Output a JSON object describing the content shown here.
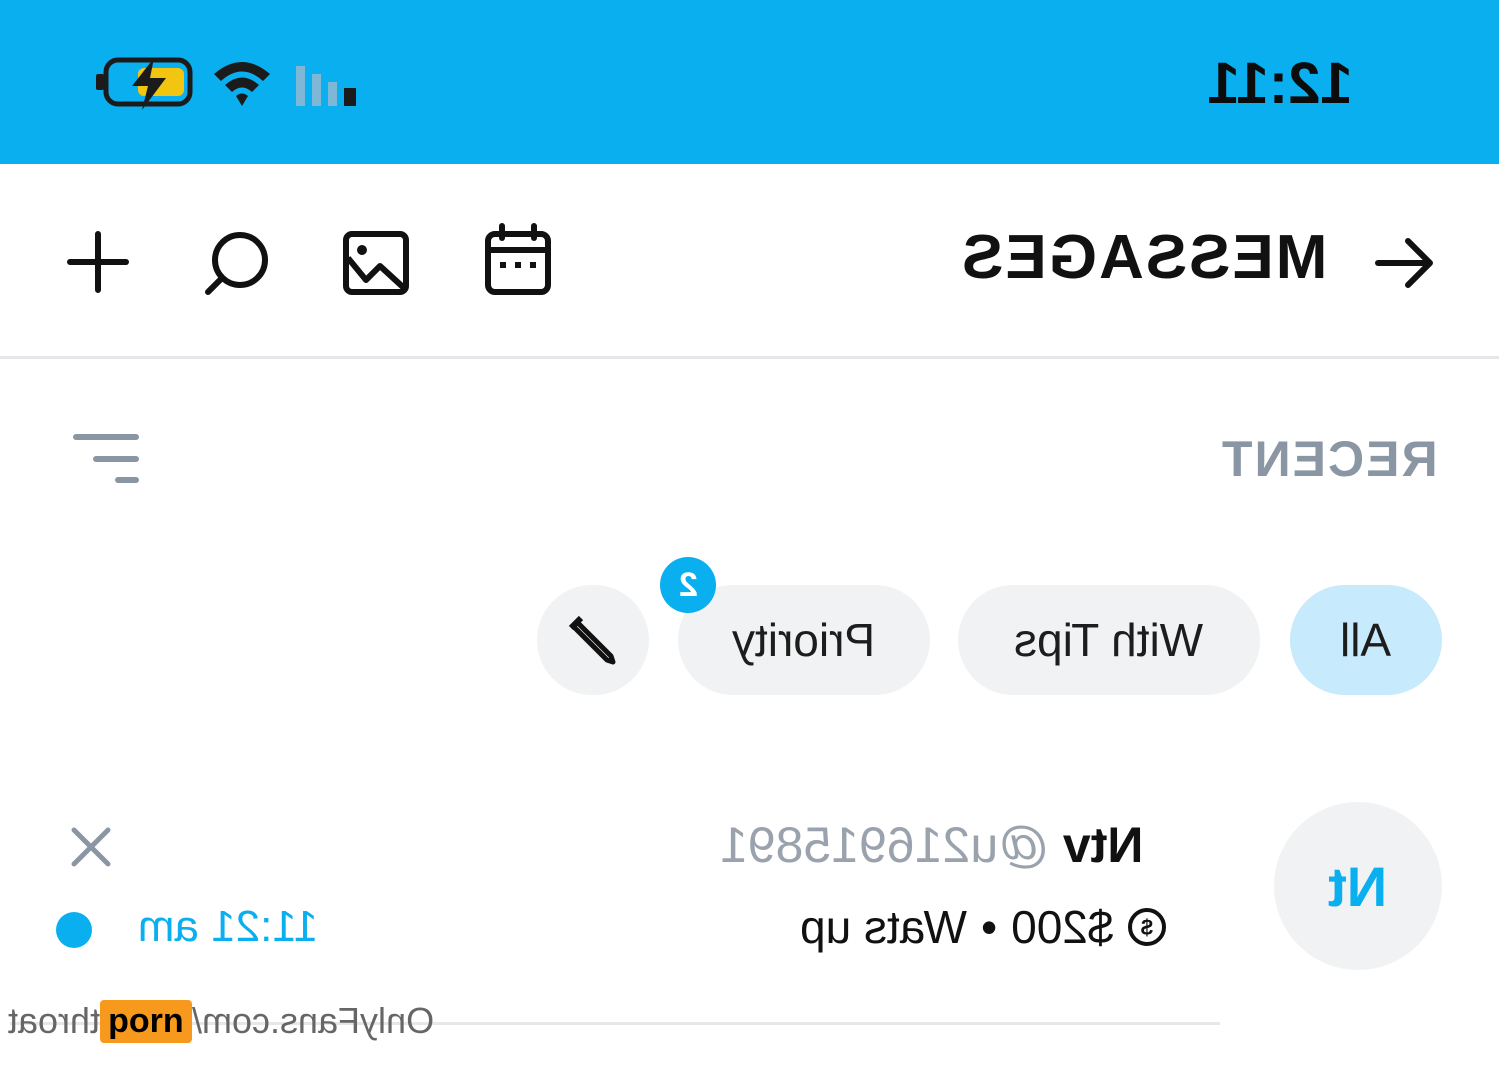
{
  "status_bar": {
    "time": "12:11",
    "icons": [
      "battery-charging-icon",
      "wifi-icon",
      "signal-icon"
    ]
  },
  "header": {
    "title": "MESSAGES",
    "icons": [
      "back-arrow-icon",
      "calendar-icon",
      "image-icon",
      "search-icon",
      "plus-icon"
    ]
  },
  "section": {
    "label": "RECENT",
    "filter_icon": "sort-lines-icon"
  },
  "chips": [
    {
      "label": "All",
      "active": true
    },
    {
      "label": "With Tips",
      "active": false
    },
    {
      "label": "Priority",
      "active": false,
      "badge": "2"
    }
  ],
  "conversation": {
    "avatar_initials": "Nt",
    "name": "Ntv",
    "handle": "@u216915891",
    "amount": "$200",
    "separator": "•",
    "message": "Wats up",
    "time": "11:21 am"
  },
  "watermark": {
    "text": "OnlyFans.com/",
    "tag": "porn",
    "suffix": "throat"
  },
  "colors": {
    "accent": "#0aaff0",
    "chip_active": "#c7eafd",
    "chip_bg": "#f1f2f3",
    "muted": "#8a96a3"
  }
}
